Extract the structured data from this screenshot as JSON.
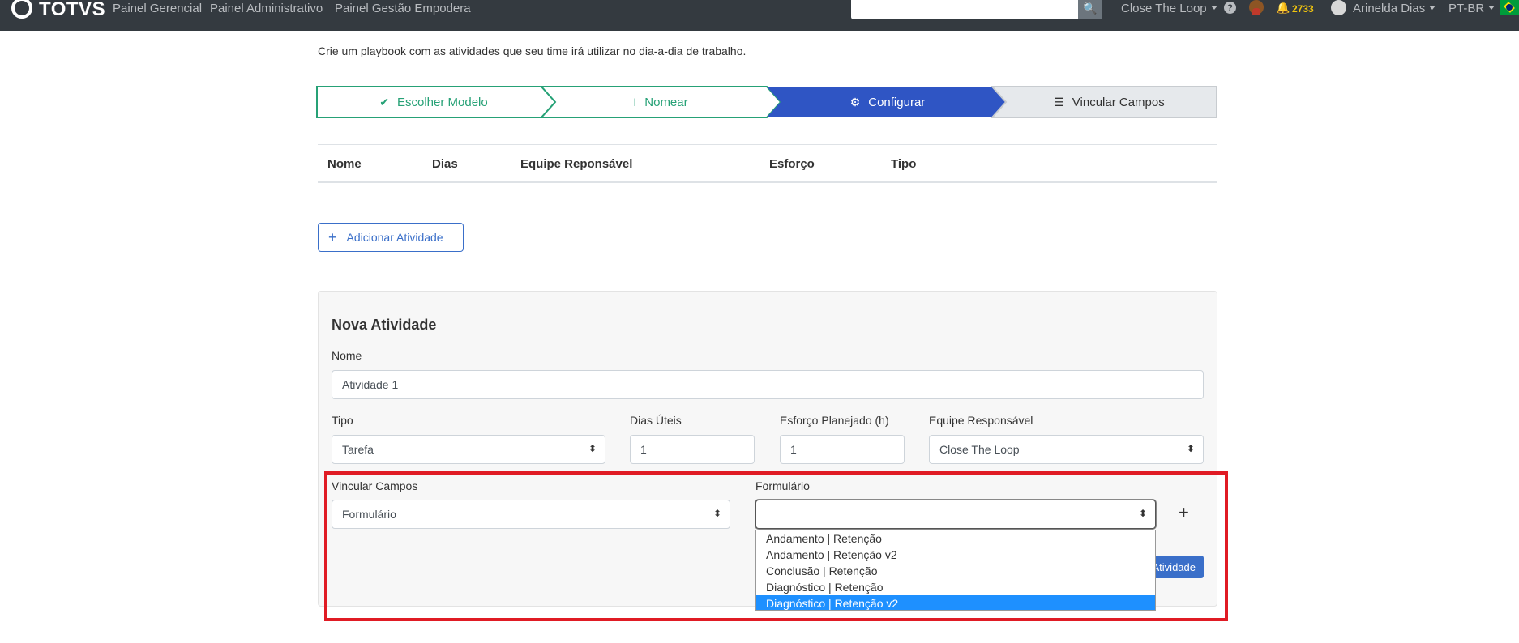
{
  "navbar": {
    "brand": "TOTVS",
    "links": [
      "Painel Gerencial",
      "Painel Administrativo",
      "Painel Gestão Empodera"
    ],
    "search_placeholder": "",
    "company": "Close The Loop",
    "notifications": "2733",
    "user": "Arinelda Dias",
    "language": "PT-BR"
  },
  "page": {
    "subtitle": "Crie um playbook com as atividades que seu time irá utilizar no dia-a-dia de trabalho."
  },
  "stepper": {
    "steps": [
      {
        "label": "Escolher Modelo",
        "icon": "double-check-icon",
        "state": "done"
      },
      {
        "label": "Nomear",
        "icon": "text-cursor-icon",
        "state": "done"
      },
      {
        "label": "Configurar",
        "icon": "gear-icon",
        "state": "active"
      },
      {
        "label": "Vincular Campos",
        "icon": "layers-icon",
        "state": "next"
      }
    ],
    "colors": {
      "done": "#26a176",
      "active": "#2f55c4",
      "next": "#e6e9ec"
    }
  },
  "table": {
    "headers": [
      "Nome",
      "Dias",
      "Equipe Reponsável",
      "Esforço",
      "Tipo"
    ]
  },
  "add_activity_label": "Adicionar Atividade",
  "form": {
    "title": "Nova Atividade",
    "nome_label": "Nome",
    "nome_value": "Atividade 1",
    "tipo_label": "Tipo",
    "tipo_value": "Tarefa",
    "dias_label": "Dias Úteis",
    "dias_value": "1",
    "esforco_label": "Esforço Planejado (h)",
    "esforco_value": "1",
    "equipe_label": "Equipe Responsável",
    "equipe_value": "Close The Loop",
    "vincular_label": "Vincular Campos",
    "vincular_value": "Formulário",
    "formulario_label": "Formulário",
    "formulario_value": "",
    "save_label": "Atividade"
  },
  "dropdown": {
    "options": [
      "Andamento | Retenção",
      "Andamento | Retenção v2",
      "Conclusão | Retenção",
      "Diagnóstico | Retenção",
      "Diagnóstico | Retenção v2"
    ],
    "selected": "Diagnóstico | Retenção v2"
  },
  "colors": {
    "accent": "#3a6fc9",
    "highlight": "#e01b24",
    "selection": "#1e90ff"
  }
}
